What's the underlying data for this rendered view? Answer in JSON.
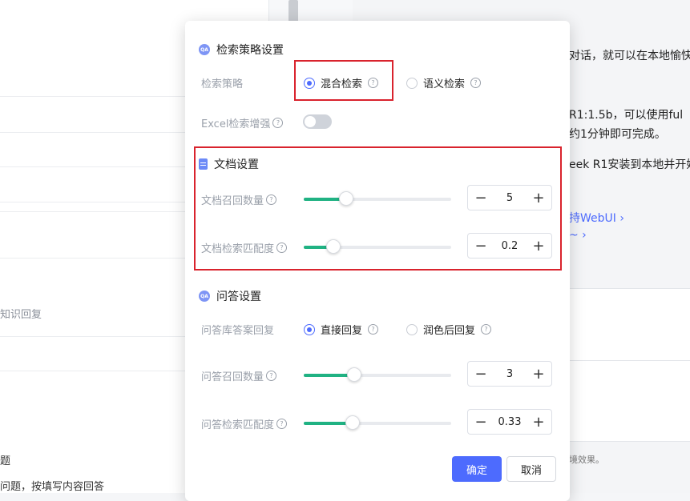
{
  "background": {
    "left_lines": [
      "知识回复",
      "题",
      "问题，按填写内容回答"
    ],
    "right_lines": [
      "对话，就可以在本地愉快",
      "R1:1.5b，可以使用ful",
      "约1分钟即可完成。",
      "eek R1安装到本地并开始"
    ],
    "right_links": [
      "持WebUI",
      "~"
    ],
    "right_hint": "境效果。"
  },
  "modal": {
    "retrieval": {
      "title": "检索策略设置",
      "strategy_label": "检索策略",
      "options": [
        {
          "label": "混合检索",
          "selected": true
        },
        {
          "label": "语义检索",
          "selected": false
        }
      ],
      "excel_label": "Excel检索增强",
      "excel_enabled": false
    },
    "document": {
      "title": "文档设置",
      "recall_label": "文档召回数量",
      "recall_value": "5",
      "recall_level": 0.29,
      "match_label": "文档检索匹配度",
      "match_value": "0.2",
      "match_level": 0.2
    },
    "qa": {
      "title": "问答设置",
      "reply_label": "问答库答案回复",
      "reply_options": [
        {
          "label": "直接回复",
          "selected": true
        },
        {
          "label": "润色后回复",
          "selected": false
        }
      ],
      "recall_label": "问答召回数量",
      "recall_value": "3",
      "recall_level": 0.34,
      "match_label": "问答检索匹配度",
      "match_value": "0.33",
      "match_level": 0.33
    },
    "buttons": {
      "confirm": "确定",
      "cancel": "取消"
    },
    "icons": {
      "qa": "QA"
    }
  },
  "colors": {
    "accent": "#4d6bfe",
    "slider": "#20b283",
    "highlight": "#d9232d"
  }
}
